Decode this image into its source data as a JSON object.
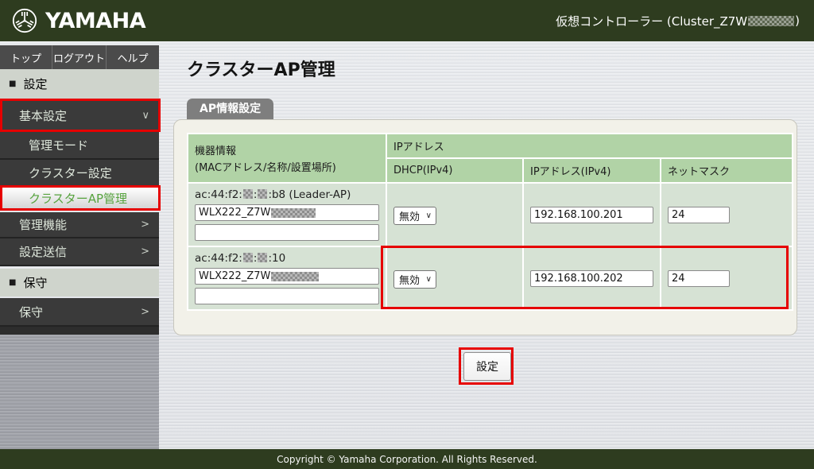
{
  "titlebar": {
    "brand": "YAMAHA",
    "controller_prefix": "仮想コントローラー (Cluster_Z7W",
    "controller_suffix": ")"
  },
  "nav": {
    "tabs": [
      "トップ",
      "ログアウト",
      "ヘルプ"
    ]
  },
  "sidebar": {
    "sections": {
      "settings": "設定",
      "maintenance": "保守"
    },
    "items": {
      "basic": "基本設定",
      "mgmt_mode": "管理モード",
      "cluster": "クラスター設定",
      "cluster_ap": "クラスターAP管理",
      "mgmt_func": "管理機能",
      "send": "設定送信",
      "maint": "保守"
    }
  },
  "icons": {
    "section_bullet": "■",
    "chevron_down": "∨",
    "chevron_right": ">",
    "select_arrow": "∨"
  },
  "main": {
    "title": "クラスターAP管理",
    "tab": "AP情報設定",
    "table": {
      "col_device": "機器情報",
      "col_device_sub": "(MACアドレス/名称/設置場所)",
      "col_ip_group": "IPアドレス",
      "col_dhcp": "DHCP(IPv4)",
      "col_ip": "IPアドレス(IPv4)",
      "col_netmask": "ネットマスク",
      "rows": [
        {
          "mac_prefix": "ac:44:f2:",
          "mac_mid_sep": ":",
          "mac_suffix": ":b8 (Leader-AP)",
          "name_prefix": "WLX222_Z7W",
          "location": "",
          "dhcp": "無効",
          "ip": "192.168.100.201",
          "netmask": "24"
        },
        {
          "mac_prefix": "ac:44:f2:",
          "mac_mid_sep": ":",
          "mac_suffix": ":10",
          "name_prefix": "WLX222_Z7W",
          "location": "",
          "dhcp": "無効",
          "ip": "192.168.100.202",
          "netmask": "24"
        }
      ]
    },
    "submit_label": "設定"
  },
  "footer": {
    "copyright": "Copyright © Yamaha Corporation. All Rights Reserved."
  },
  "colors": {
    "annotation_red": "#e60000",
    "brand_green": "#2e3c1f",
    "table_header_green": "#b1d3a6",
    "table_cell_green": "#d6e2d4",
    "active_item_green": "#57a33e"
  }
}
